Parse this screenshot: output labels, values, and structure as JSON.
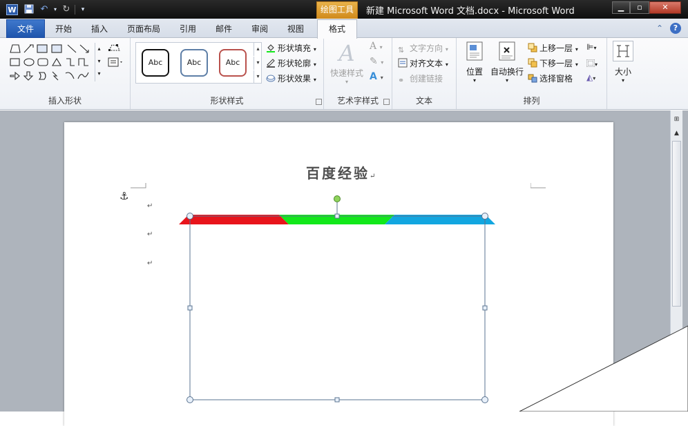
{
  "window": {
    "title": "新建 Microsoft Word 文档.docx  -  Microsoft Word",
    "contextual_tab": "绘图工具"
  },
  "tabs": {
    "file": "文件",
    "items": [
      "开始",
      "插入",
      "页面布局",
      "引用",
      "邮件",
      "审阅",
      "视图"
    ],
    "active": "格式"
  },
  "ribbon": {
    "insert_shapes": {
      "label": "插入形状"
    },
    "shape_styles": {
      "label": "形状样式",
      "gallery": [
        "Abc",
        "Abc",
        "Abc"
      ],
      "fill": "形状填充",
      "outline": "形状轮廓",
      "effects": "形状效果"
    },
    "wordart": {
      "label": "艺术字样式",
      "quick_styles": "快速样式"
    },
    "text": {
      "label": "文本",
      "direction": "文字方向",
      "align": "对齐文本",
      "link": "创建链接"
    },
    "arrange": {
      "label": "排列",
      "position": "位置",
      "wrap": "自动换行",
      "bring_forward": "上移一层",
      "send_backward": "下移一层",
      "selection_pane": "选择窗格"
    },
    "size": {
      "label": "大小"
    }
  },
  "document": {
    "title": "百度经验"
  },
  "colors": {
    "bar_red": "#e8141b",
    "bar_green": "#12e81a",
    "bar_blue": "#12a6e0",
    "accent_blue": "#2b5aa8"
  }
}
